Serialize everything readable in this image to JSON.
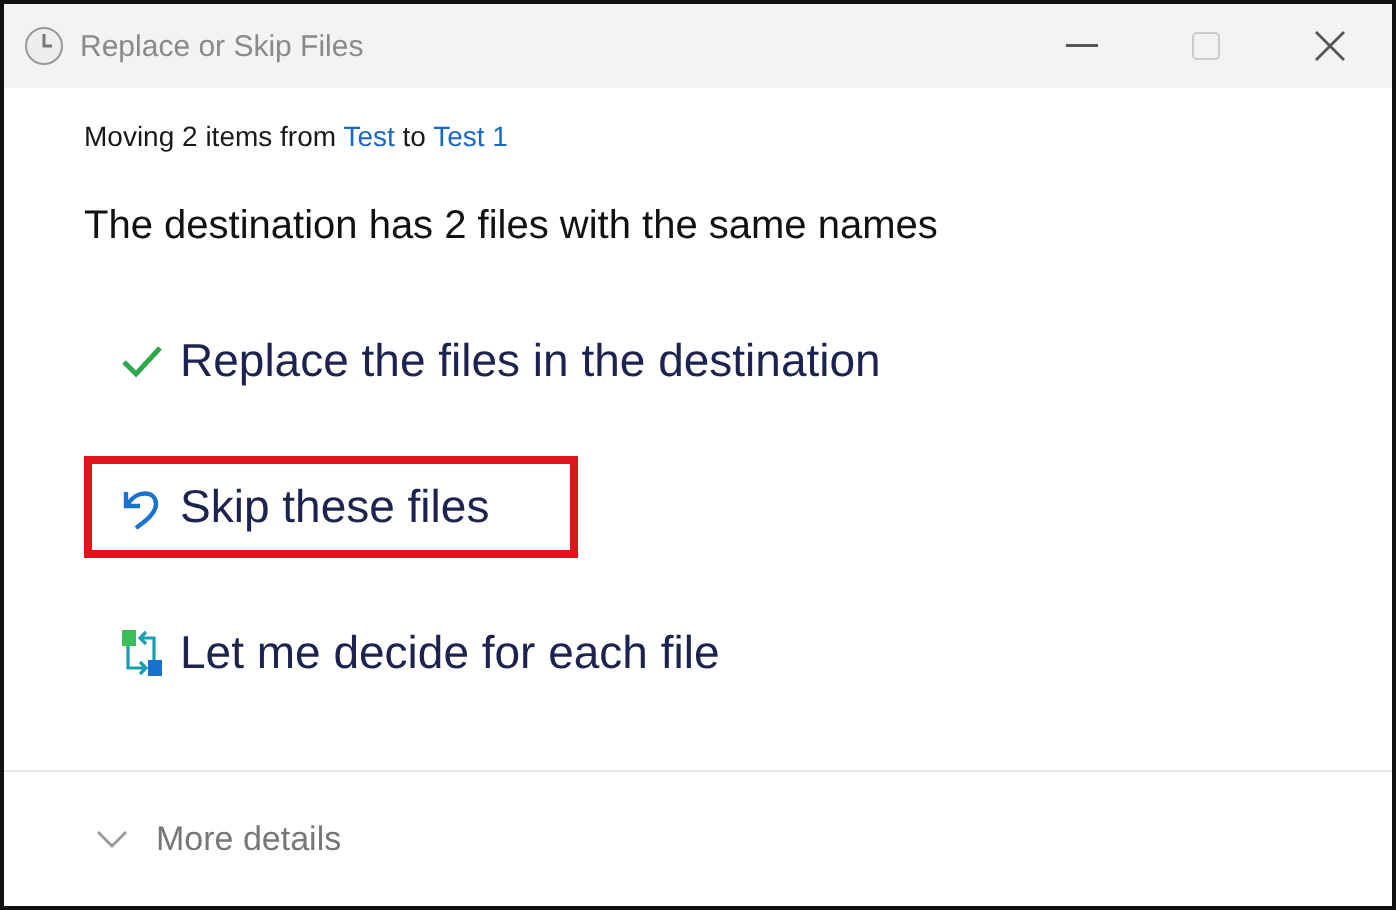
{
  "window": {
    "title": "Replace or Skip Files"
  },
  "moving": {
    "prefix": "Moving 2 items from",
    "source": "Test",
    "joiner": "to",
    "destination": "Test 1"
  },
  "heading": "The destination has 2 files with the same names",
  "options": [
    {
      "kind": "replace",
      "label": "Replace the files in the destination",
      "highlighted": false
    },
    {
      "kind": "skip",
      "label": "Skip these files",
      "highlighted": true
    },
    {
      "kind": "decide",
      "label": "Let me decide for each file",
      "highlighted": false
    }
  ],
  "footer": {
    "label": "More details",
    "expanded": false
  }
}
